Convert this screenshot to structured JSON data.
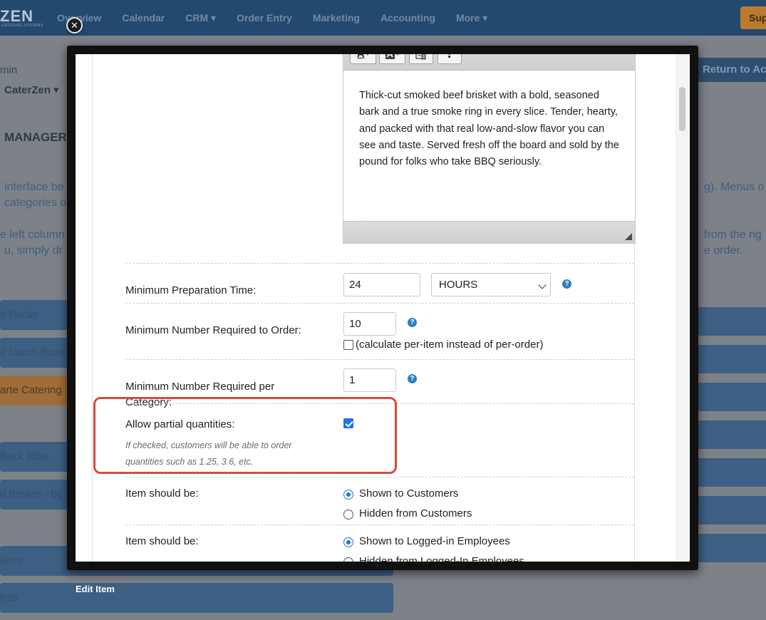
{
  "app": {
    "logo": "ZEN",
    "logo_sub": "CATERING SYSTEMS",
    "nav": [
      "Overview",
      "Calendar",
      "CRM ▾",
      "Order Entry",
      "Marketing",
      "Accounting",
      "More ▾"
    ],
    "support_label": "Sup",
    "return_label": "Return to Ac",
    "user_role": "min",
    "company": "CaterZen ▾",
    "section_title": "MANAGER",
    "bg_line1": "interface be",
    "bg_line2": "categories o",
    "bg_line3": "e left column",
    "bg_line4": "u, simply dr",
    "bg_right1": "g). Menus o",
    "bg_right2": "from the rig",
    "bg_right3": "e order.",
    "bg_items": [
      "d Packs",
      "d Lunch Boxes",
      "arte Catering",
      "Back Ribs -",
      "d Brisket - by",
      "tions",
      "tras"
    ]
  },
  "modal": {
    "caption": "Edit Item",
    "close_symbol": "✕",
    "editor": {
      "btn_font_color": "A",
      "btn_bg_color": "A",
      "btn_help": "?",
      "text": "Thick-cut smoked beef brisket with a bold, seasoned bark and a true smoke ring in every slice. Tender, hearty, and packed with that real low-and-slow flavor you can see and taste. Served fresh off the board and sold by the pound for folks who take BBQ seriously."
    },
    "min_prep": {
      "label": "Minimum Preparation Time:",
      "value": "24",
      "unit": "HOURS"
    },
    "min_order": {
      "label": "Minimum Number Required to Order:",
      "value": "10",
      "checkbox_label": "(calculate per-item instead of per-order)",
      "checked": false
    },
    "min_category": {
      "label": "Minimum Number Required per Category:",
      "value": "1"
    },
    "partial": {
      "label": "Allow partial quantities:",
      "checked": true,
      "hint": "If checked, customers will be able to order quantities such as 1.25, 3.6, etc."
    },
    "visibility_customers": {
      "label": "Item should be:",
      "options": [
        "Shown to Customers",
        "Hidden from Customers"
      ],
      "selected": 0
    },
    "visibility_employees": {
      "label": "Item should be:",
      "options": [
        "Shown to Logged-in Employees",
        "Hidden from Logged-In Employees"
      ],
      "selected": 0
    },
    "help_symbol": "?"
  },
  "colors": {
    "accent": "#2f7fc1",
    "highlight": "#d94a3d",
    "checkbox": "#1f72e8"
  }
}
